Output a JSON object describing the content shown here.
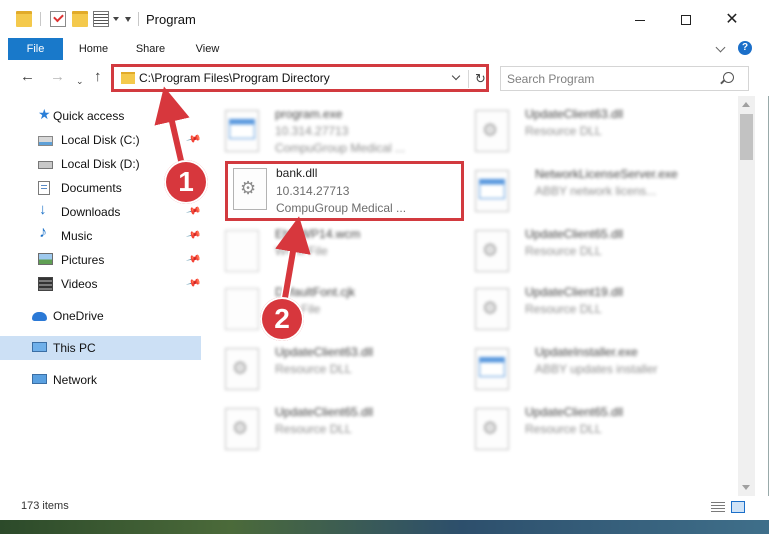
{
  "window": {
    "title": "Program"
  },
  "ribbon": {
    "tabs": [
      "File",
      "Home",
      "Share",
      "View"
    ]
  },
  "nav": {
    "address": "C:\\Program Files\\Program Directory",
    "search_placeholder": "Search Program"
  },
  "sidebar": {
    "items": [
      {
        "label": "Quick access",
        "icon": "star-icon",
        "pinned": false
      },
      {
        "label": "Local Disk (C:)",
        "icon": "disk-icon",
        "pinned": true
      },
      {
        "label": "Local Disk (D:)",
        "icon": "disk-icon",
        "pinned": false
      },
      {
        "label": "Documents",
        "icon": "documents-icon",
        "pinned": true
      },
      {
        "label": "Downloads",
        "icon": "download-icon",
        "pinned": true
      },
      {
        "label": "Music",
        "icon": "music-icon",
        "pinned": true
      },
      {
        "label": "Pictures",
        "icon": "pictures-icon",
        "pinned": true
      },
      {
        "label": "Videos",
        "icon": "videos-icon",
        "pinned": true
      },
      {
        "label": "OneDrive",
        "icon": "cloud-icon",
        "pinned": false
      },
      {
        "label": "This PC",
        "icon": "computer-icon",
        "pinned": false,
        "selected": true
      },
      {
        "label": "Network",
        "icon": "network-icon",
        "pinned": false
      }
    ]
  },
  "files": {
    "highlighted": {
      "name": "bank.dll",
      "line1": "10.314.27713",
      "line2": "CompuGroup Medical ..."
    },
    "left": [
      {
        "name": "program.exe",
        "line1": "10.314.27713",
        "line2": "CompuGroup Medical ..."
      },
      {
        "name": "EhtoWP14.wcm",
        "line1": "WCM File",
        "line2": ""
      },
      {
        "name": "DefaultFont.cjk",
        "line1": "CJK File",
        "line2": ""
      },
      {
        "name": "UpdateClient63.dll",
        "line1": "Resource DLL",
        "line2": ""
      },
      {
        "name": "UpdateClient65.dll",
        "line1": "Resource DLL",
        "line2": ""
      }
    ],
    "right": [
      {
        "name": "UpdateClient63.dll",
        "line1": "Resource DLL",
        "line2": ""
      },
      {
        "name": "NetworkLicenseServer.exe",
        "line1": "ABBY network licens...",
        "line2": ""
      },
      {
        "name": "UpdateClient65.dll",
        "line1": "Resource DLL",
        "line2": ""
      },
      {
        "name": "UpdateClient19.dll",
        "line1": "Resource DLL",
        "line2": ""
      },
      {
        "name": "UpdateInstaller.exe",
        "line1": "ABBY updates installer",
        "line2": ""
      },
      {
        "name": "UpdateClient65.dll",
        "line1": "Resource DLL",
        "line2": ""
      }
    ]
  },
  "status": {
    "item_count": "173 items"
  },
  "annotations": {
    "callout_1": "1",
    "callout_2": "2"
  },
  "colors": {
    "accent": "#1979ca",
    "highlight": "#d23a3f"
  }
}
